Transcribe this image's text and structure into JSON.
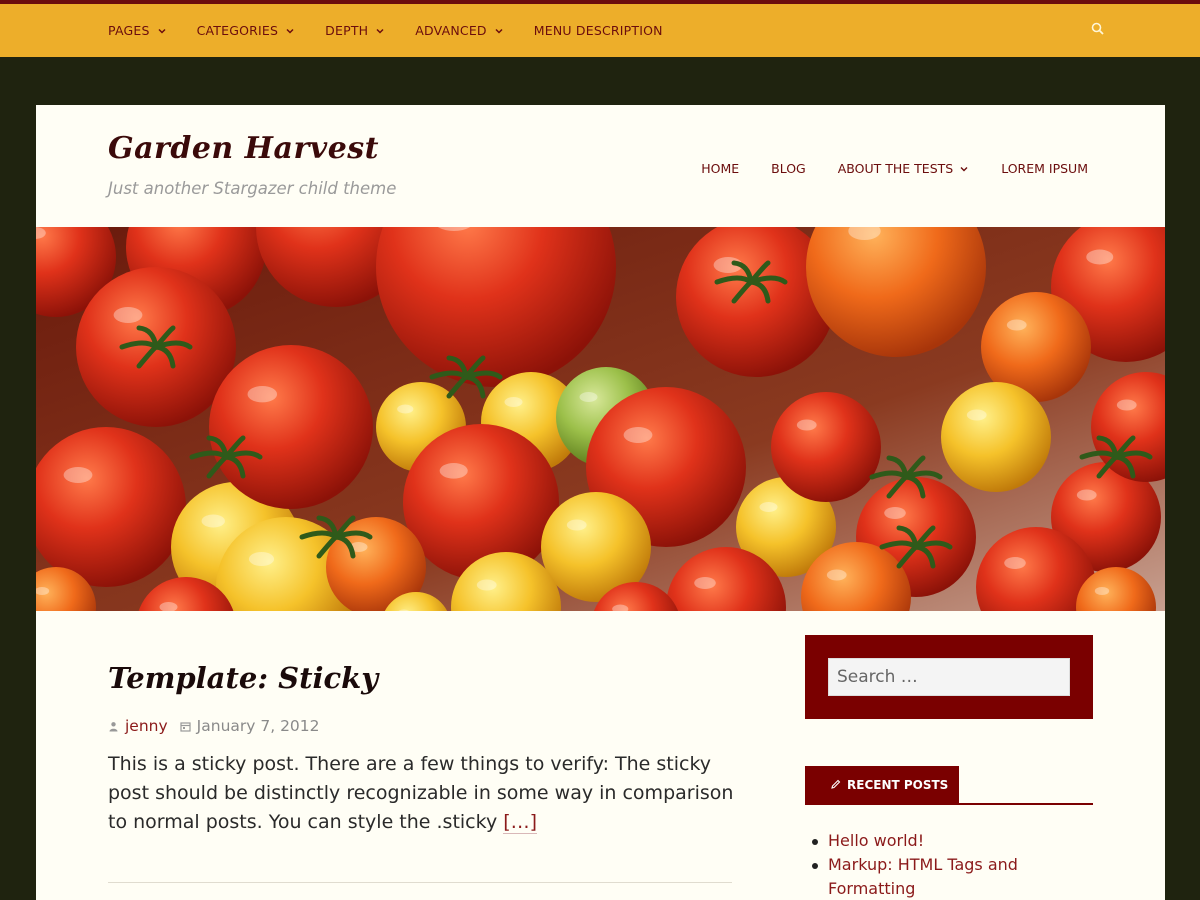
{
  "topbar": {
    "items": [
      {
        "label": "PAGES",
        "has_dropdown": true
      },
      {
        "label": "CATEGORIES",
        "has_dropdown": true
      },
      {
        "label": "DEPTH",
        "has_dropdown": true
      },
      {
        "label": "ADVANCED",
        "has_dropdown": true
      },
      {
        "label": "MENU DESCRIPTION",
        "has_dropdown": false
      }
    ],
    "search_icon": "search-icon"
  },
  "site": {
    "title": "Garden Harvest",
    "description": "Just another Stargazer child theme"
  },
  "mainnav": {
    "items": [
      {
        "label": "HOME",
        "has_dropdown": false
      },
      {
        "label": "BLOG",
        "has_dropdown": false
      },
      {
        "label": "ABOUT THE TESTS",
        "has_dropdown": true
      },
      {
        "label": "LOREM IPSUM",
        "has_dropdown": false
      }
    ]
  },
  "hero": {
    "subject": "tomatoes"
  },
  "post": {
    "title": "Template: Sticky",
    "author": "jenny",
    "date": "January 7, 2012",
    "excerpt": "This is a sticky post. There are a few things to verify: The sticky post should be distinctly recognizable in some way in comparison to normal posts. You can style the .sticky",
    "more_label": "[…]"
  },
  "sidebar": {
    "search": {
      "placeholder": "Search …"
    },
    "recent_posts": {
      "heading": "RECENT POSTS",
      "items": [
        "Hello world!",
        "Markup: HTML Tags and Formatting"
      ]
    }
  },
  "colors": {
    "topbar": "#edae2a",
    "accent": "#7a0000",
    "page_bg": "#1f230f",
    "card_bg": "#fffef5"
  }
}
